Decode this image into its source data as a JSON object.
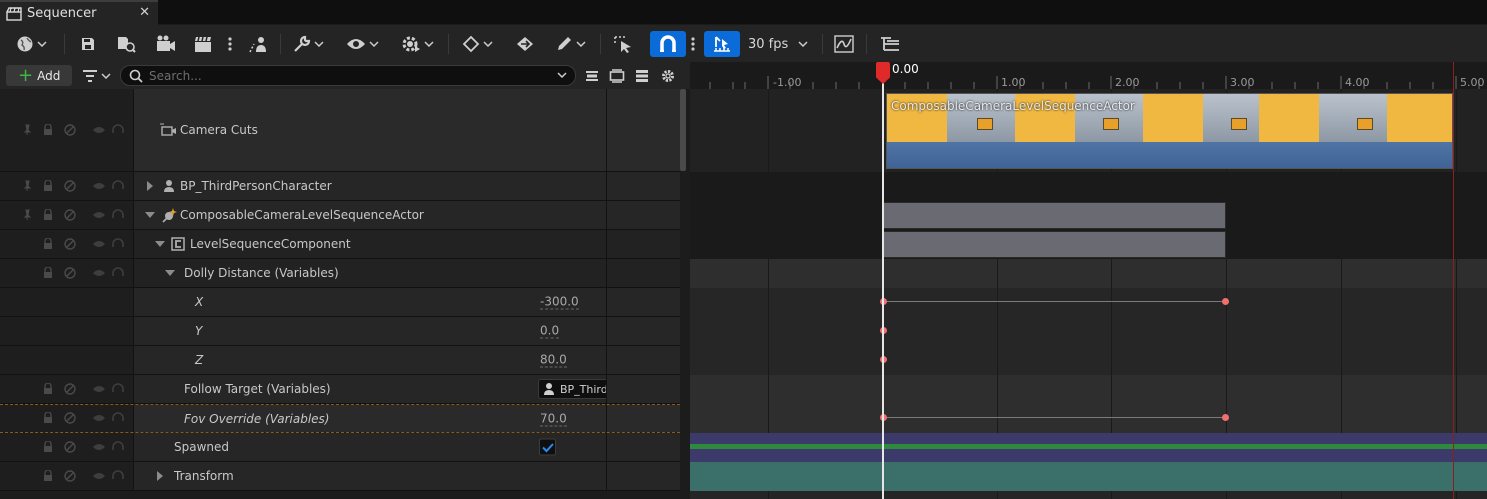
{
  "tab": {
    "title": "Sequencer",
    "icon": "clapperboard-icon",
    "close_label": "✕"
  },
  "toolbar": {
    "fps_label": "30 fps",
    "icons": [
      "world-icon",
      "save-icon",
      "browse-icon",
      "render-camera-icon",
      "render-movie-icon",
      "more-icon",
      "actor-icon",
      "wrench-icon",
      "eye-icon",
      "gear-play-icon",
      "key-icon",
      "bake-icon",
      "pencil-icon",
      "select-tool-icon",
      "snap-magnet-icon",
      "playhead-snap-icon",
      "curve-editor-icon",
      "tree-view-icon"
    ],
    "snap_color": "#0b6bd8"
  },
  "filter": {
    "add_label": "Add",
    "search_placeholder": "Search..."
  },
  "ruler": {
    "labels": [
      "-1.00",
      "0.00",
      "1.00",
      "2.00",
      "3.00",
      "4.00",
      "5.00"
    ],
    "playhead_color": "#e02a2a"
  },
  "tracks": {
    "camera_cuts": {
      "label": "Camera Cuts",
      "section_label": "ComposableCameraLevelSequenceActor"
    },
    "bp_third_person": {
      "label": "BP_ThirdPersonCharacter"
    },
    "composable_actor": {
      "label": "ComposableCameraLevelSequenceActor"
    },
    "level_sequence_component": {
      "label": "LevelSequenceComponent"
    },
    "dolly_distance": {
      "label": "Dolly Distance (Variables)"
    },
    "x": {
      "label": "X",
      "value": "-300.0"
    },
    "y": {
      "label": "Y",
      "value": "0.0"
    },
    "z": {
      "label": "Z",
      "value": "80.0"
    },
    "follow_target": {
      "label": "Follow Target (Variables)",
      "value": "BP_ThirdPer"
    },
    "fov_override": {
      "label": "Fov Override (Variables)",
      "value": "70.0"
    },
    "spawned": {
      "label": "Spawned",
      "checked": true
    },
    "transform": {
      "label": "Transform"
    }
  },
  "colors": {
    "key_point": "#f07070",
    "spawned_track": "#3c3a6a",
    "spawned_bar": "#2e8a3c",
    "transform_track": "#3a6f6a"
  }
}
